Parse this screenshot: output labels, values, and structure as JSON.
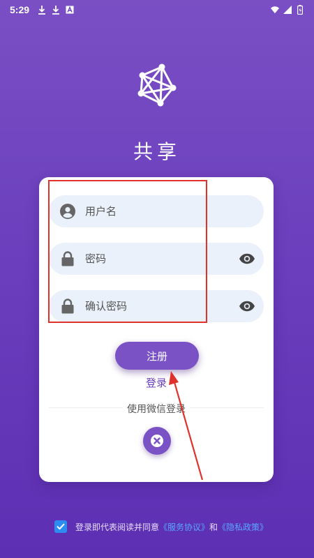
{
  "status_bar": {
    "time": "5:29",
    "icons_left": [
      "download-icon",
      "download-icon",
      "text-icon"
    ],
    "icons_right": [
      "wifi-icon",
      "signal-icon",
      "battery-icon"
    ]
  },
  "app": {
    "title": "共享",
    "logo_icon": "network-icon"
  },
  "form": {
    "username_placeholder": "用户名",
    "password_placeholder": "密码",
    "confirm_placeholder": "确认密码",
    "register_label": "注册",
    "login_label": "登录",
    "wechat_label": "使用微信登录"
  },
  "agreement": {
    "checked": true,
    "prefix": "登录即代表阅读并同意",
    "terms": "《服务协议》",
    "conjunction": "和",
    "privacy": "《隐私政策》"
  },
  "colors": {
    "background_top": "#7a4fc4",
    "background_bottom": "#5d2fb3",
    "accent": "#7a52c6",
    "field_bg": "#eaf1fa",
    "annotation": "#e0322d",
    "link": "#58a6ff"
  }
}
